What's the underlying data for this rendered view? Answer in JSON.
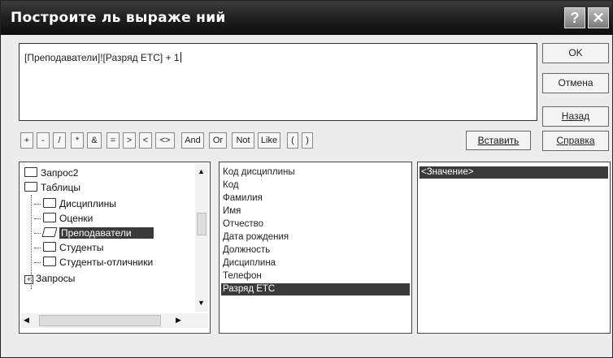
{
  "window": {
    "title": "Построите ль выраже ний",
    "help_glyph": "?",
    "close_glyph": "✕"
  },
  "expression": {
    "value": "[Преподаватели]![Разряд ETC] + 1"
  },
  "buttons": {
    "ok": "OK",
    "cancel": "Отмена",
    "undo": "Назад",
    "paste": "Вставить",
    "help": "Справка"
  },
  "operators": [
    "+",
    "-",
    "/",
    "*",
    "&",
    "=",
    ">",
    "<",
    "<>",
    "And",
    "Or",
    "Not",
    "Like",
    "(",
    ")"
  ],
  "tree": {
    "items": [
      {
        "label": "Запрос2",
        "type": "folder"
      },
      {
        "label": "Таблицы",
        "type": "folder-open-minus"
      },
      {
        "label": "Дисциплины",
        "type": "folder"
      },
      {
        "label": "Оценки",
        "type": "folder"
      },
      {
        "label": "Преподаватели",
        "type": "folder-open"
      },
      {
        "label": "Студенты",
        "type": "folder"
      },
      {
        "label": "Студенты-отличники",
        "type": "folder"
      },
      {
        "label": "Запросы",
        "type": "plus"
      }
    ],
    "selected": "Преподаватели"
  },
  "fields": {
    "items": [
      "Код дисциплины",
      "Код",
      "Фамилия",
      "Имя",
      "Отчество",
      "Дата рождения",
      "Должность",
      "Дисциплина",
      "Телефон",
      "Разряд ETC"
    ],
    "selected": "Разряд ETC"
  },
  "values": {
    "items": [
      "<Значение>"
    ],
    "selected": "<Значение>"
  },
  "colors": {
    "titlebar": "#1e1e1e",
    "selection": "#3a3a3a"
  }
}
